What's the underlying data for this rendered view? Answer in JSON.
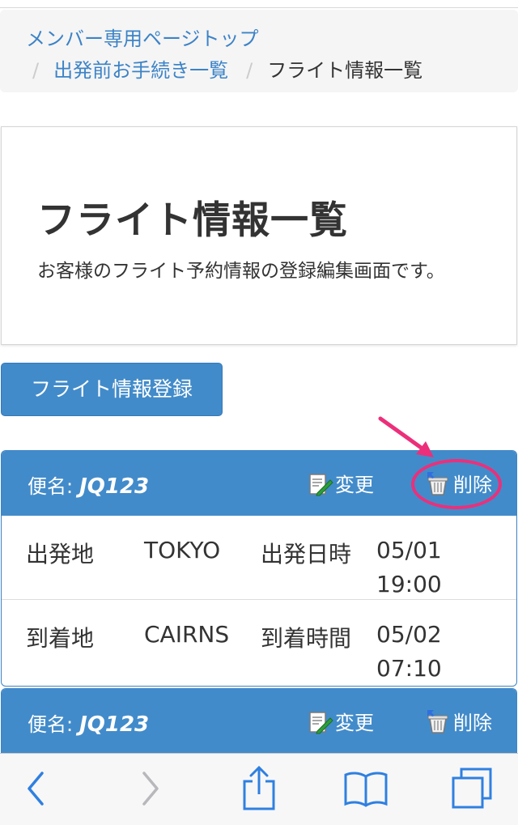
{
  "breadcrumb": {
    "home": "メンバー専用ページトップ",
    "separator": "/",
    "procedures": "出発前お手続き一覧",
    "current": "フライト情報一覧"
  },
  "page": {
    "title": "フライト情報一覧",
    "description": "お客様のフライト予約情報の登録編集画面です。"
  },
  "register_button": "フライト情報登録",
  "flights": [
    {
      "label": "便名:",
      "flight_no": "JQ123",
      "edit": "変更",
      "delete": "削除",
      "rows": [
        {
          "k1": "出発地",
          "v1": "TOKYO",
          "k2": "出発日時",
          "v2": "05/01 19:00"
        },
        {
          "k1": "到着地",
          "v1": "CAIRNS",
          "k2": "到着時間",
          "v2": "05/02 07:10"
        }
      ]
    },
    {
      "label": "便名:",
      "flight_no": "JQ123",
      "edit": "変更",
      "delete": "削除"
    }
  ],
  "colors": {
    "primary": "#428bca",
    "link": "#3c83c7",
    "annotation": "#ec2f7a",
    "toolbar_icon": "#2f80e0"
  },
  "toolbar_icons": [
    "back-icon",
    "forward-icon",
    "share-icon",
    "bookmarks-icon",
    "tabs-icon"
  ]
}
